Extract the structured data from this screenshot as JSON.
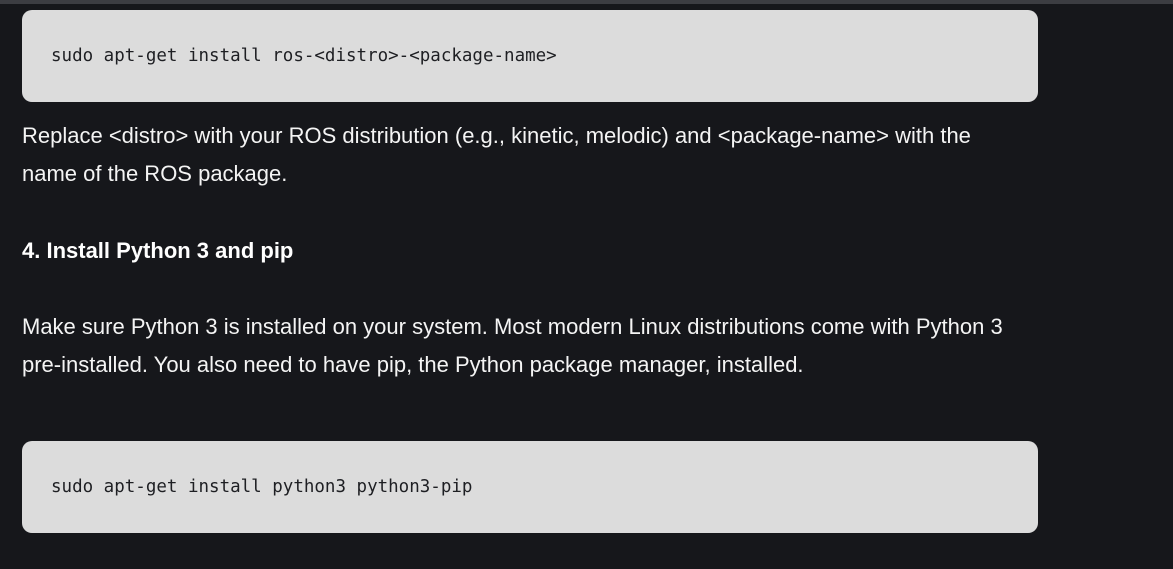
{
  "code_blocks": [
    {
      "text": "sudo apt-get install ros-<distro>-<package-name>"
    },
    {
      "text": "sudo apt-get install python3 python3-pip"
    }
  ],
  "paragraphs": [
    {
      "text": "Replace <distro> with your ROS distribution (e.g., kinetic, melodic) and <package-name> with the name of the ROS package."
    },
    {
      "text": "Make sure Python 3 is installed on your system. Most modern Linux distributions come with Python 3 pre-installed. You also need to have pip, the Python package manager, installed."
    }
  ],
  "section": {
    "heading": "4. Install Python 3 and pip"
  },
  "colors": {
    "background": "#16171b",
    "code_background": "#dcdcdc",
    "text": "#f4f4f4"
  }
}
